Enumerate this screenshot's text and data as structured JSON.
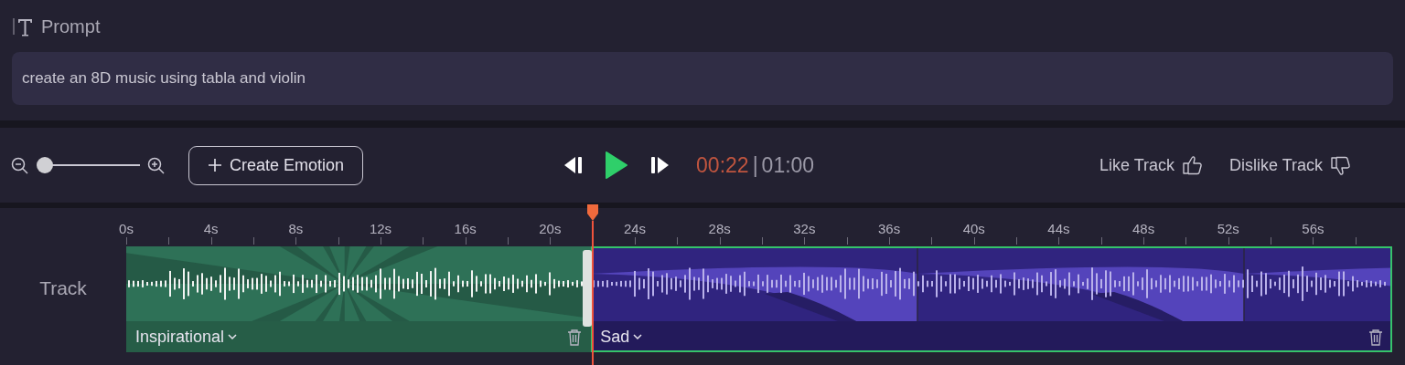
{
  "prompt": {
    "label": "Prompt",
    "value": "create an 8D music using tabla and violin"
  },
  "controls": {
    "zoom": {
      "level": 0.05
    },
    "create_button": "Create Emotion",
    "current_time": "00:22",
    "separator": "|",
    "total_time": "01:00",
    "like": "Like Track",
    "dislike": "Dislike Track"
  },
  "timeline": {
    "track_label": "Track",
    "playhead": {
      "level": 0.367
    },
    "ticks": [
      "0s",
      "4s",
      "8s",
      "12s",
      "16s",
      "20s",
      "24s",
      "28s",
      "32s",
      "36s",
      "40s",
      "44s",
      "48s",
      "52s",
      "56s"
    ],
    "segments": [
      {
        "kind": "rays",
        "label": "Inspirational",
        "color": "#2e7157",
        "selected": false
      },
      {
        "kind": "waves",
        "label": "Sad",
        "color": "#4534b5",
        "selected": true
      }
    ]
  }
}
